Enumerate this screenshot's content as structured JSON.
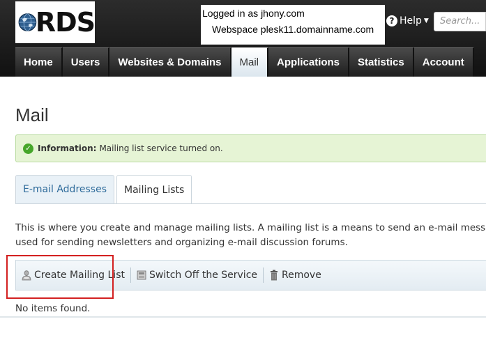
{
  "header": {
    "logo_text": "RDS",
    "login_line": "Logged in as jhony.com",
    "webspace_line": "Webspace plesk11.domainname.com",
    "help_label": "Help",
    "search_placeholder": "Search..."
  },
  "nav": {
    "tabs": [
      {
        "label": "Home",
        "active": false
      },
      {
        "label": "Users",
        "active": false
      },
      {
        "label": "Websites & Domains",
        "active": false
      },
      {
        "label": "Mail",
        "active": true
      },
      {
        "label": "Applications",
        "active": false
      },
      {
        "label": "Statistics",
        "active": false
      },
      {
        "label": "Account",
        "active": false
      }
    ]
  },
  "main": {
    "title": "Mail",
    "info": {
      "label": "Information:",
      "text": "Mailing list service turned on."
    },
    "subtabs": [
      {
        "label": "E-mail Addresses",
        "active": false
      },
      {
        "label": "Mailing Lists",
        "active": true
      }
    ],
    "description": [
      "This is where you create and manage mailing lists. A mailing list is a means to send an e-mail message to multiple recipients",
      "used for sending newsletters and organizing e-mail discussion forums."
    ],
    "toolbar": {
      "create_label": "Create Mailing List",
      "switch_off_label": "Switch Off the Service",
      "remove_label": "Remove"
    },
    "empty_text": "No items found."
  },
  "colors": {
    "header_bg": "#1e1e1e",
    "info_bg": "#e6f4d5",
    "link_blue": "#2d6a9a",
    "highlight_red": "#d32020"
  }
}
